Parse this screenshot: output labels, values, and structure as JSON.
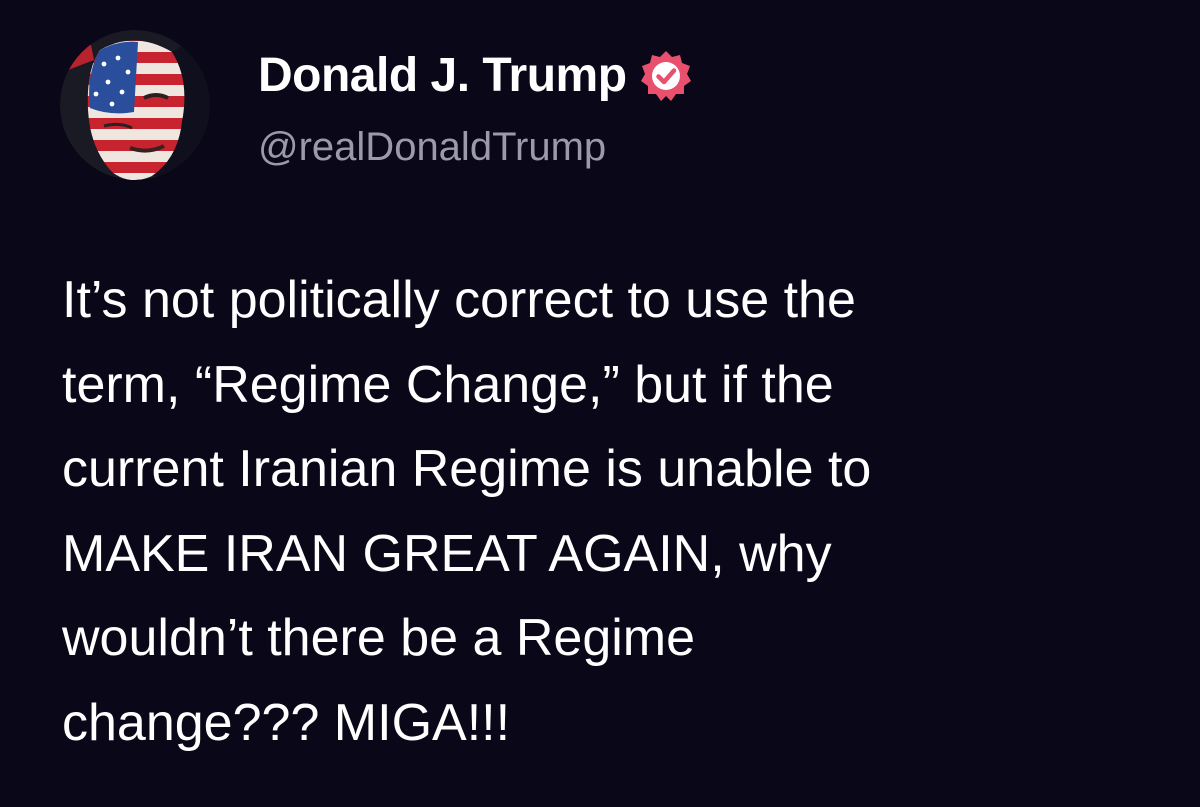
{
  "author": {
    "display_name": "Donald J. Trump",
    "handle": "@realDonaldTrump",
    "verified_icon": "verified-badge-icon",
    "avatar": "profile-avatar"
  },
  "post": {
    "lines": [
      "It’s not politically correct to use the",
      "term, “Regime Change,” but if the",
      "current Iranian Regime is unable to",
      "MAKE IRAN GREAT AGAIN, why",
      "wouldn’t there be a Regime",
      "change??? MIGA!!!"
    ]
  },
  "colors": {
    "background": "#0a0818",
    "text": "#ffffff",
    "handle": "#9c9aaa",
    "verified": "#e8506e"
  }
}
